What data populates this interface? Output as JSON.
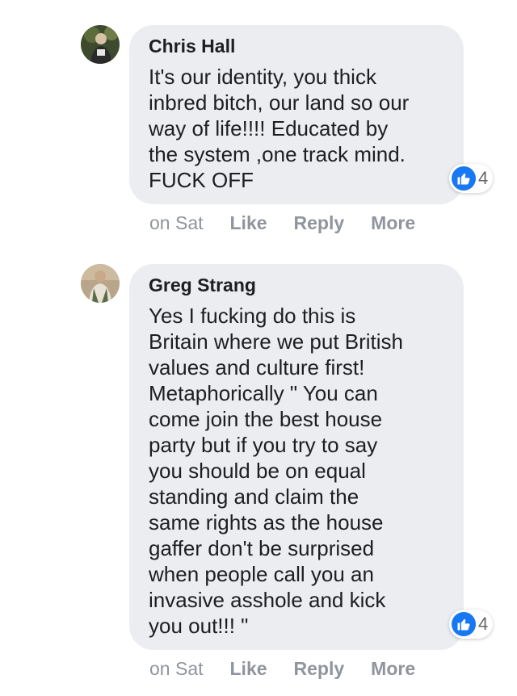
{
  "comments": [
    {
      "author": "Chris Hall",
      "text": "It's our identity, you thick\ninbred bitch, our land so our\nway of life!!!! Educated by\nthe system ,one track mind.\nFUCK OFF",
      "reaction_count": "4",
      "reaction_icon": "like-icon",
      "timestamp": "on Sat",
      "like_label": "Like",
      "reply_label": "Reply",
      "more_label": "More"
    },
    {
      "author": "Greg Strang",
      "text": "Yes I fucking do this is\nBritain where we put British\nvalues and culture first!\nMetaphorically \" You can\ncome join the best house\nparty but if you try to say\nyou should be on equal\nstanding and claim the\nsame rights as the house\ngaffer don't be surprised\nwhen people call you an\ninvasive asshole and kick\nyou out!!! \"",
      "reaction_count": "4",
      "reaction_icon": "like-icon",
      "timestamp": "on Sat",
      "like_label": "Like",
      "reply_label": "Reply",
      "more_label": "More"
    }
  ],
  "colors": {
    "bubble": "#ebedf0",
    "like_blue": "#1877f2",
    "meta_gray": "#90949c",
    "text": "#1c1e21"
  }
}
